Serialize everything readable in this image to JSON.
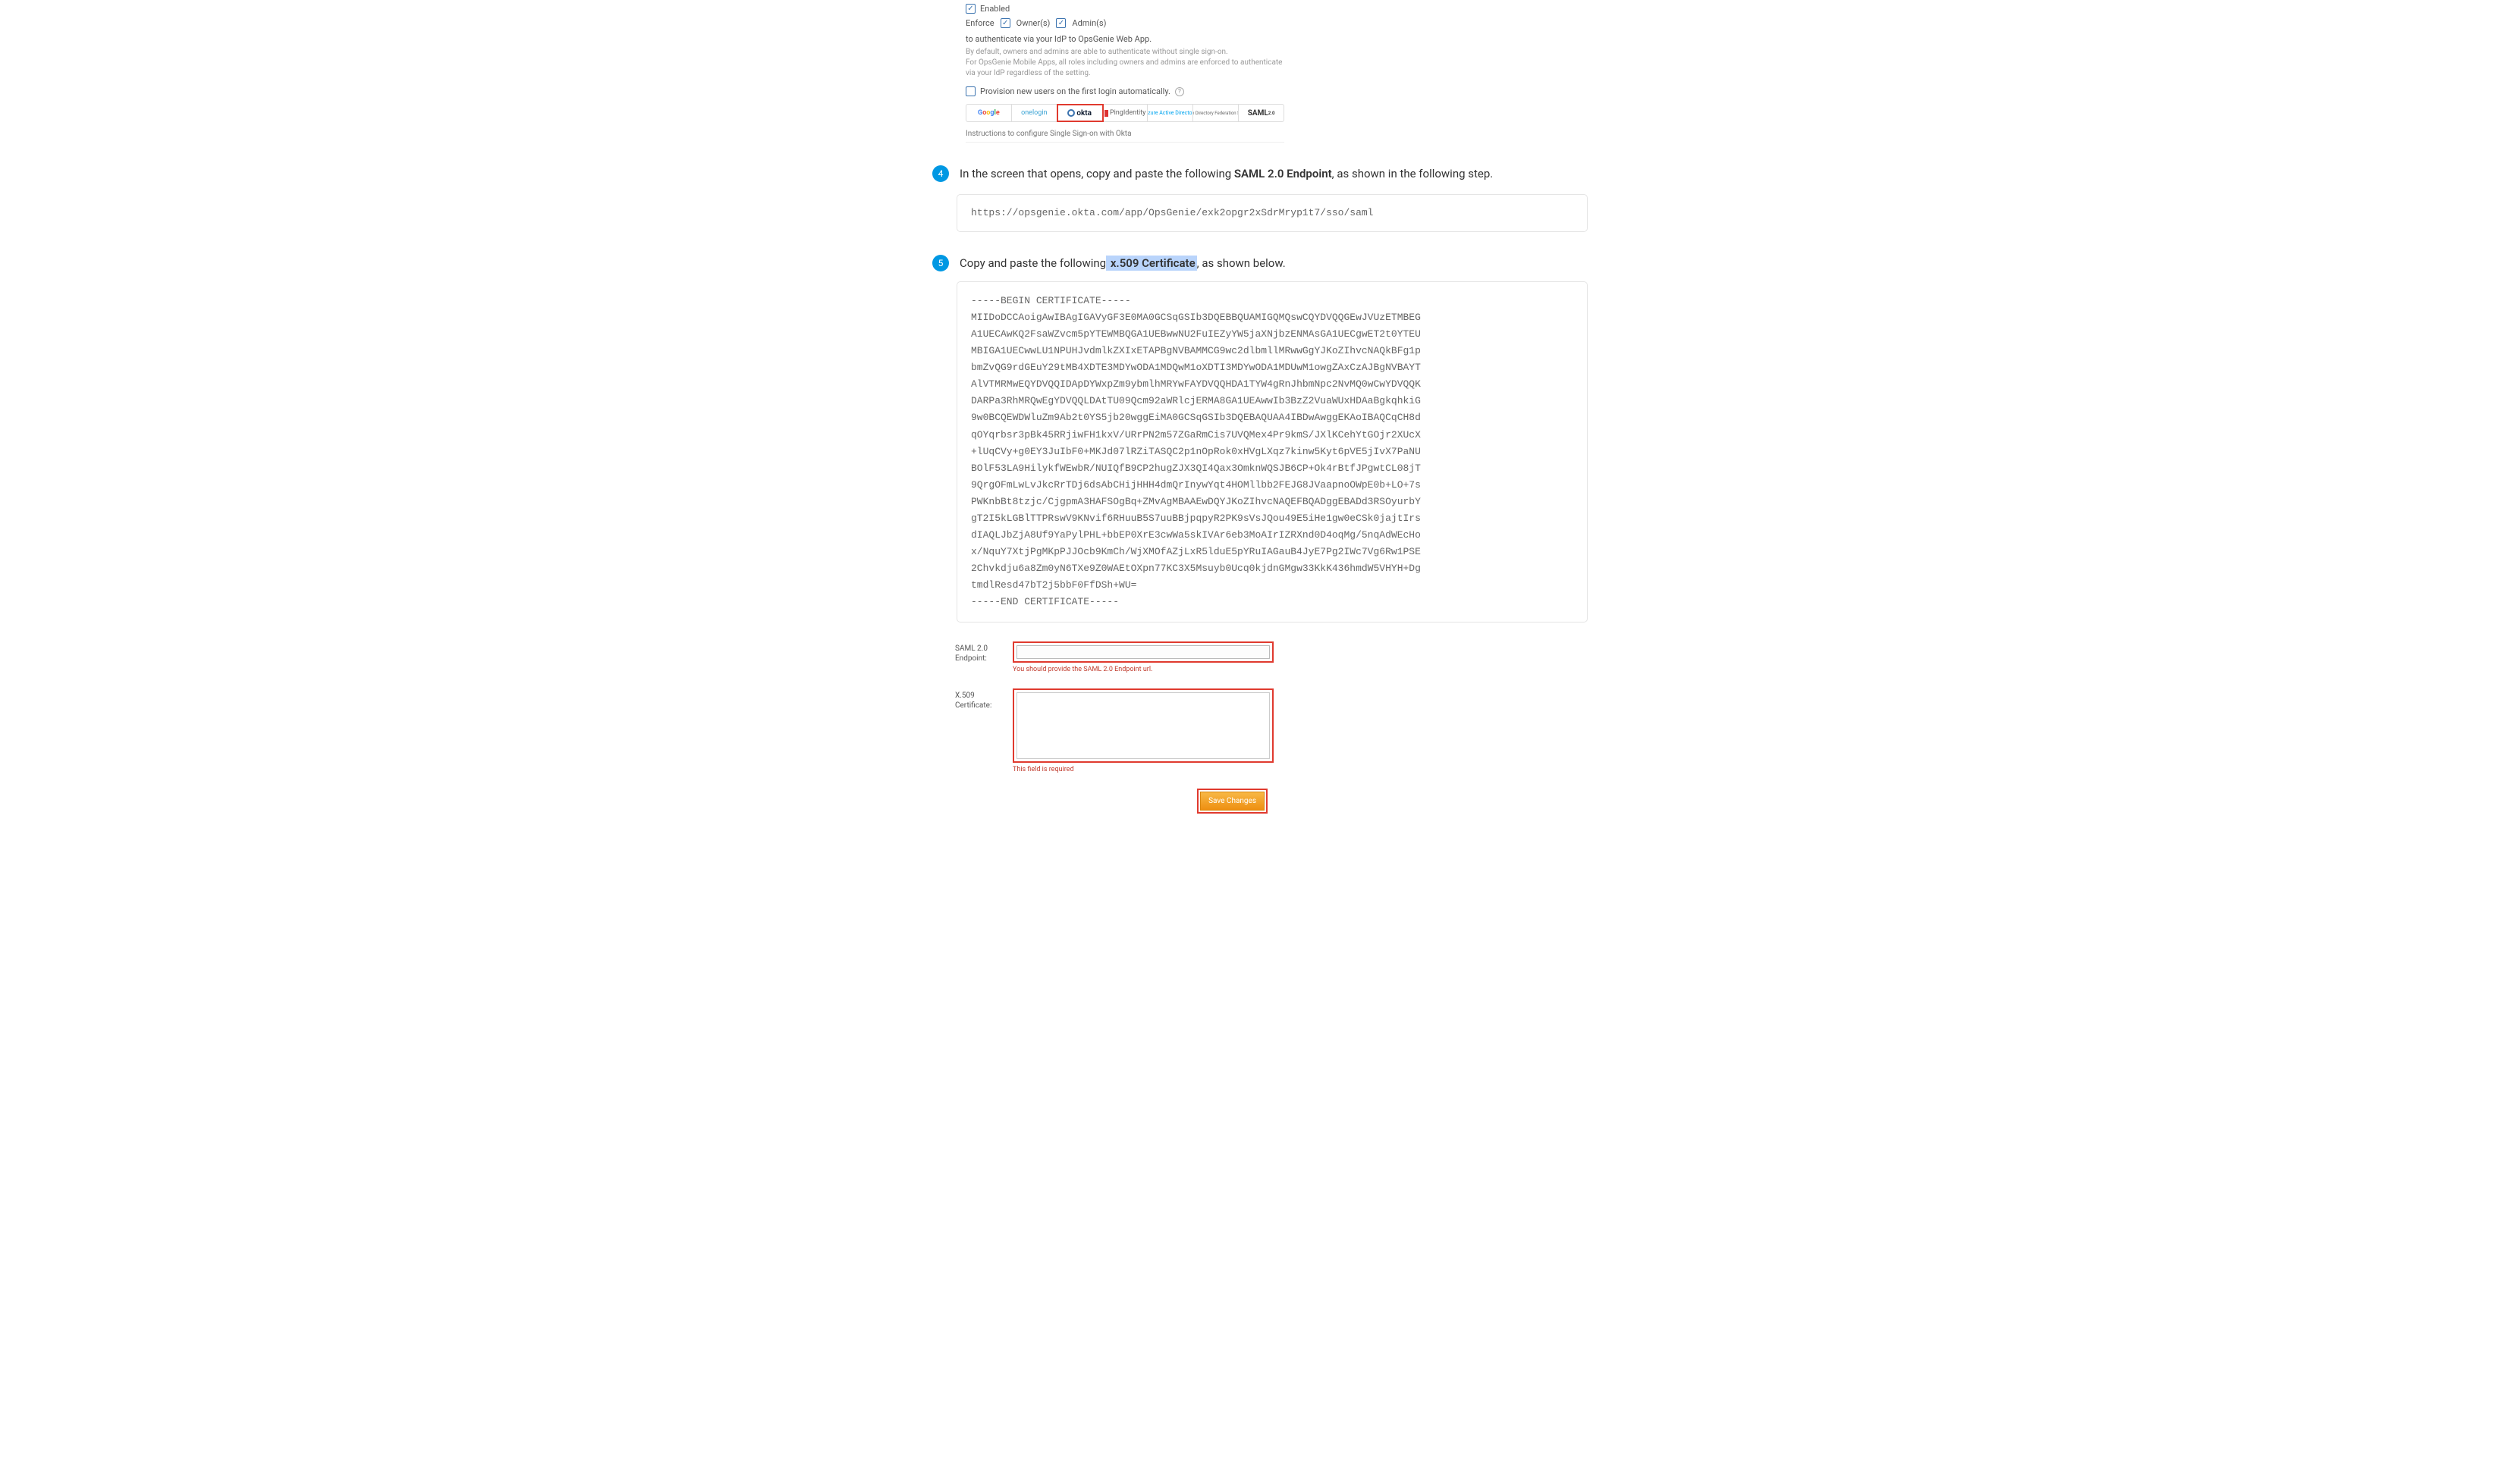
{
  "sso_panel": {
    "enabled_label": "Enabled",
    "enforce_label": "Enforce",
    "owner_label": "Owner(s)",
    "admin_label": "Admin(s)",
    "enforce_tail": "to authenticate via your IdP to OpsGenie Web App.",
    "note1": "By default, owners and admins are able to authenticate without single sign-on.",
    "note2": "For OpsGenie Mobile Apps, all roles including owners and admins are enforced to authenticate via your IdP regardless of the setting.",
    "provision_label": "Provision new users on the first login automatically.",
    "providers": {
      "google": "Google",
      "onelogin": "onelogin",
      "okta": "okta",
      "ping": "PingIdentity",
      "azure": "Azure Active Directory",
      "adfs": "Active Directory Federation Services",
      "saml": "SAML"
    },
    "instructions": "Instructions to configure Single Sign-on with Okta"
  },
  "steps": {
    "s4_num": "4",
    "s4_pre": "In the screen that opens, copy and paste the following ",
    "s4_bold": "SAML 2.0 Endpoint",
    "s4_post": ", as shown in the following step.",
    "endpoint_url": "https://opsgenie.okta.com/app/OpsGenie/exk2opgr2xSdrMryp1t7/sso/saml",
    "s5_num": "5",
    "s5_pre": "Copy and paste the following",
    "s5_hl": " x.509 Certificate",
    "s5_post": ", as shown below.",
    "certificate": "-----BEGIN CERTIFICATE-----\nMIIDoDCCAoigAwIBAgIGAVyGF3E0MA0GCSqGSIb3DQEBBQUAMIGQMQswCQYDVQQGEwJVUzETMBEG\nA1UECAwKQ2FsaWZvcm5pYTEWMBQGA1UEBwwNU2FuIEZyYW5jaXNjbzENMAsGA1UECgwET2t0YTEU\nMBIGA1UECwwLU1NPUHJvdmlkZXIxETAPBgNVBAMMCG9wc2dlbmllMRwwGgYJKoZIhvcNAQkBFg1p\nbmZvQG9rdGEuY29tMB4XDTE3MDYwODA1MDQwM1oXDTI3MDYwODA1MDUwM1owgZAxCzAJBgNVBAYT\nAlVTMRMwEQYDVQQIDApDYWxpZm9ybmlhMRYwFAYDVQQHDA1TYW4gRnJhbmNpc2NvMQ0wCwYDVQQK\nDARPa3RhMRQwEgYDVQQLDAtTU09Qcm92aWRlcjERMA8GA1UEAwwIb3BzZ2VuaWUxHDAaBgkqhkiG\n9w0BCQEWDWluZm9Ab2t0YS5jb20wggEiMA0GCSqGSIb3DQEBAQUAA4IBDwAwggEKAoIBAQCqCH8d\nqOYqrbsr3pBk45RRjiwFH1kxV/URrPN2m57ZGaRmCis7UVQMex4Pr9kmS/JXlKCehYtGOjr2XUcX\n+lUqCVy+g0EY3JuIbF0+MKJd07lRZiTASQC2p1nOpRok0xHVgLXqz7kinw5Kyt6pVE5jIvX7PaNU\nBOlF53LA9HilykfWEwbR/NUIQfB9CP2hugZJX3QI4Qax3OmknWQSJB6CP+Ok4rBtfJPgwtCL08jT\n9QrgOFmLwLvJkcRrTDj6dsAbCHijHHH4dmQrInywYqt4HOMllbb2FEJG8JVaapnoOWpE0b+LO+7s\nPWKnbBt8tzjc/CjgpmA3HAFSOgBq+ZMvAgMBAAEwDQYJKoZIhvcNAQEFBQADggEBADd3RSOyurbY\ngT2I5kLGBlTTPRswV9KNvif6RHuuB5S7uuBBjpqpyR2PK9sVsJQou49E5iHe1gw0eCSk0jajtIrs\ndIAQLJbZjA8Uf9YaPylPHL+bbEP0XrE3cwWa5skIVAr6eb3MoAIrIZRXnd0D4oqMg/5nqAdWEcHo\nx/NquY7XtjPgMKpPJJOcb9KmCh/WjXMOfAZjLxR5lduE5pYRuIAGauB4JyE7Pg2IWc7Vg6Rw1PSE\n2Chvkdju6a8Zm0yN6TXe9Z0WAEtOXpn77KC3X5Msuyb0Ucq0kjdnGMgw33KkK436hmdW5VHYH+Dg\ntmdlResd47bT2j5bbF0FfDSh+WU=\n-----END CERTIFICATE-----"
  },
  "form": {
    "endpoint_label": "SAML 2.0 Endpoint:",
    "endpoint_hint": "You should provide the SAML 2.0 Endpoint url.",
    "cert_label": "X.509 Certificate:",
    "cert_hint": "This field is required",
    "save_label": "Save Changes"
  }
}
